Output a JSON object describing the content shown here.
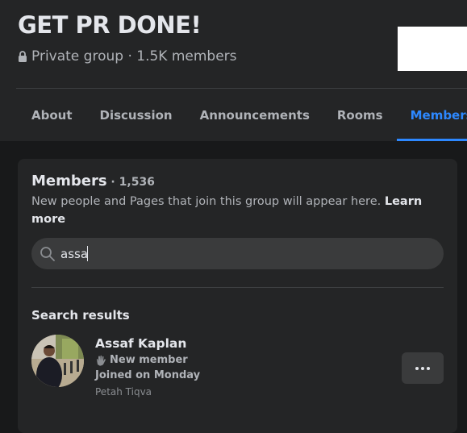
{
  "group": {
    "title": "GET PR DONE!",
    "privacy": "Private group",
    "separator": " · ",
    "member_count_short": "1.5K members"
  },
  "tabs": [
    {
      "label": "About",
      "active": false
    },
    {
      "label": "Discussion",
      "active": false
    },
    {
      "label": "Announcements",
      "active": false
    },
    {
      "label": "Rooms",
      "active": false
    },
    {
      "label": "Members",
      "active": true
    }
  ],
  "members_section": {
    "title": "Members",
    "count_prefix": " · ",
    "count": "1,536",
    "description": "New people and Pages that join this group will appear here.",
    "learn_more": "Learn more",
    "search": {
      "value": "assa",
      "icon": "search-icon"
    },
    "results_title": "Search results",
    "results": [
      {
        "name": "Assaf Kaplan",
        "badge": "New member",
        "badge_icon": "wave-icon",
        "joined": "Joined on Monday",
        "location": "Petah Tiqva",
        "more_icon": "more-dots-icon"
      }
    ]
  },
  "colors": {
    "accent": "#2d88ff",
    "background": "#18191a",
    "surface": "#242526",
    "input": "#3a3b3c"
  }
}
